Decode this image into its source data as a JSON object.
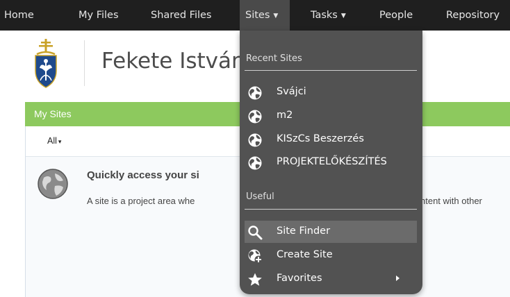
{
  "nav": {
    "items": [
      {
        "label": "Home"
      },
      {
        "label": "My Files"
      },
      {
        "label": "Shared Files"
      },
      {
        "label": "Sites",
        "arrow": "▼"
      },
      {
        "label": "Tasks",
        "arrow": "▼"
      },
      {
        "label": "People"
      },
      {
        "label": "Repository"
      }
    ]
  },
  "header": {
    "title": "Fekete István"
  },
  "dashlet": {
    "title": "My Sites",
    "filter": "All",
    "filter_arrow": "▾",
    "empty_title": "Quickly access your si",
    "empty_desc": "A site is a project area whe",
    "empty_desc_right": "ntent with other"
  },
  "sites_menu": {
    "recent_heading": "Recent Sites",
    "recent": [
      {
        "label": "Svájci",
        "icon": "globe-icon"
      },
      {
        "label": "m2",
        "icon": "globe-icon"
      },
      {
        "label": "KISzCs Beszerzés",
        "icon": "globe-icon"
      },
      {
        "label": "PROJEKTELŐKÉSZÍTÉS",
        "icon": "globe-icon"
      }
    ],
    "useful_heading": "Useful",
    "useful": [
      {
        "label": "Site Finder",
        "icon": "search-icon"
      },
      {
        "label": "Create Site",
        "icon": "create-site-icon"
      },
      {
        "label": "Favorites",
        "icon": "star-icon"
      }
    ]
  },
  "colors": {
    "nav_bg": "#1f1f1f",
    "menu_bg": "#525252",
    "menu_highlight": "#6b6b6b",
    "dashlet_header": "#8dc95e"
  }
}
